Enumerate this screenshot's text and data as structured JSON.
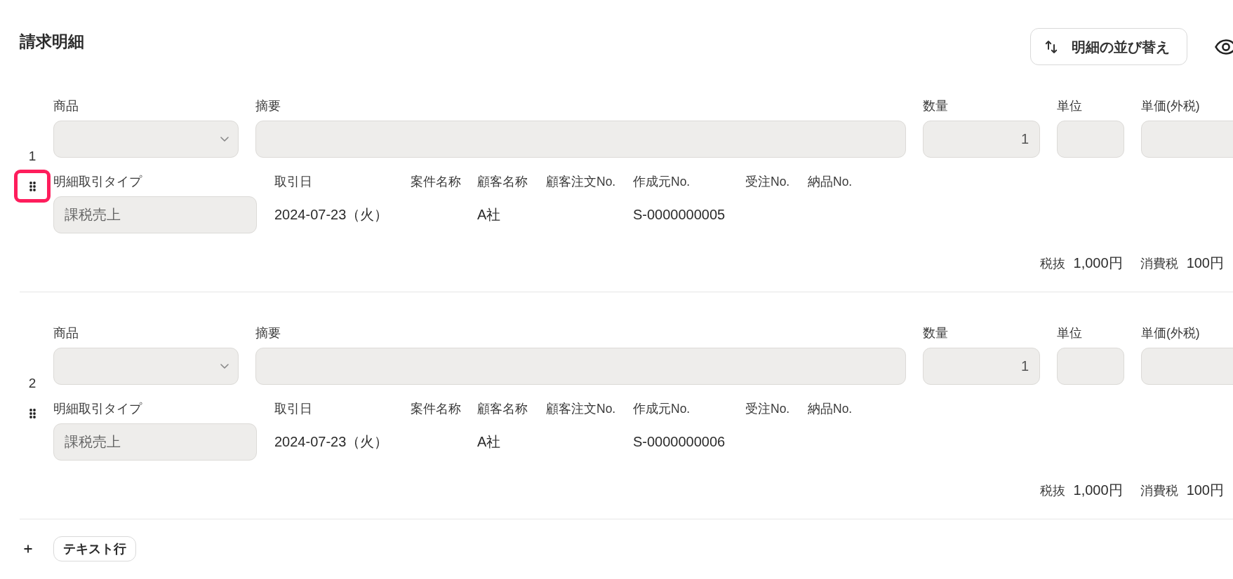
{
  "section": {
    "title": "請求明細",
    "sort_button": "明細の並び替え"
  },
  "items": [
    {
      "number": "1",
      "handle_highlighted": true,
      "fields": [
        {
          "kind": "select",
          "label": "商品"
        },
        {
          "kind": "text",
          "label": "摘要"
        },
        {
          "kind": "number",
          "label": "数量",
          "value": "1"
        },
        {
          "kind": "text",
          "label": "単位"
        },
        {
          "kind": "number",
          "label": "単価(外税)"
        }
      ],
      "details": [
        {
          "kind": "field",
          "label": "明細取引タイプ",
          "value": "課税売上"
        },
        {
          "kind": "text",
          "label": "取引日",
          "value": "2024-07-23（火）"
        },
        {
          "kind": "text",
          "label": "案件名称"
        },
        {
          "kind": "text",
          "label": "顧客名称",
          "value": "A社"
        },
        {
          "kind": "text",
          "label": "顧客注文No."
        },
        {
          "kind": "text",
          "label": "作成元No.",
          "value": "S-0000000005"
        },
        {
          "kind": "text",
          "label": "受注No."
        },
        {
          "kind": "text",
          "label": "納品No."
        }
      ],
      "totals": [
        {
          "label": "税抜",
          "value": "1,000円"
        },
        {
          "label": "消費税",
          "value": "100円"
        }
      ]
    },
    {
      "number": "2",
      "handle_highlighted": false,
      "fields": [
        {
          "kind": "select",
          "label": "商品"
        },
        {
          "kind": "text",
          "label": "摘要"
        },
        {
          "kind": "number",
          "label": "数量",
          "value": "1"
        },
        {
          "kind": "text",
          "label": "単位"
        },
        {
          "kind": "number",
          "label": "単価(外税)"
        }
      ],
      "details": [
        {
          "kind": "field",
          "label": "明細取引タイプ",
          "value": "課税売上"
        },
        {
          "kind": "text",
          "label": "取引日",
          "value": "2024-07-23（火）"
        },
        {
          "kind": "text",
          "label": "案件名称"
        },
        {
          "kind": "text",
          "label": "顧客名称",
          "value": "A社"
        },
        {
          "kind": "text",
          "label": "顧客注文No."
        },
        {
          "kind": "text",
          "label": "作成元No.",
          "value": "S-0000000006"
        },
        {
          "kind": "text",
          "label": "受注No."
        },
        {
          "kind": "text",
          "label": "納品No."
        }
      ],
      "totals": [
        {
          "label": "税抜",
          "value": "1,000円"
        },
        {
          "label": "消費税",
          "value": "100円"
        }
      ]
    }
  ],
  "add_row": {
    "button": "テキスト行"
  }
}
